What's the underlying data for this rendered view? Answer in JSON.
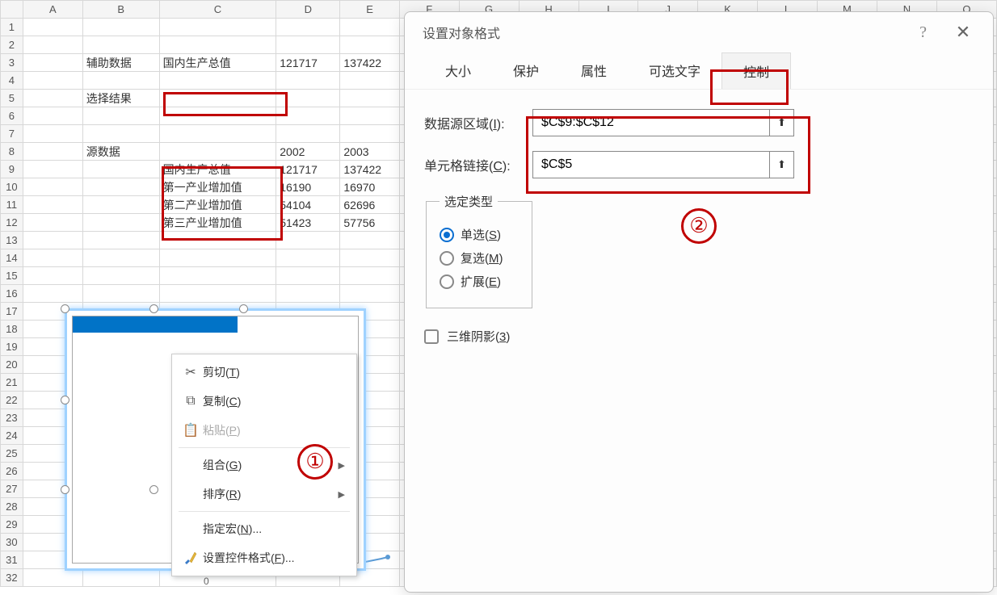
{
  "columns": [
    "A",
    "B",
    "C",
    "D",
    "E",
    "F",
    "G",
    "H",
    "I",
    "J",
    "K",
    "L",
    "M",
    "N",
    "O"
  ],
  "cells": {
    "B3": "辅助数据",
    "C3": "国内生产总值",
    "D3": "121717",
    "E3": "137422",
    "B5": "选择结果",
    "B8": "源数据",
    "D8": "2002",
    "E8": "2003",
    "C9": "国内生产总值",
    "D9": "121717",
    "E9": "137422",
    "C10": "第一产业增加值",
    "D10": "16190",
    "E10": "16970",
    "C11": "第二产业增加值",
    "D11": "54104",
    "E11": "62696",
    "C12": "第三产业增加值",
    "D12": "51423",
    "E12": "57756"
  },
  "axis_zero": "0",
  "ctx": {
    "cut": "剪切(T)",
    "copy": "复制(C)",
    "paste": "粘贴(P)",
    "group": "组合(G)",
    "sort": "排序(R)",
    "macro": "指定宏(N)...",
    "format": "设置控件格式(F)..."
  },
  "anno": {
    "one": "①",
    "two": "②"
  },
  "dialog": {
    "title": "设置对象格式",
    "tabs": {
      "size": "大小",
      "protect": "保护",
      "prop": "属性",
      "alt": "可选文字",
      "control": "控制"
    },
    "field_source": "数据源区域(I):",
    "field_link": "单元格链接(C):",
    "val_source": "$C$9:$C$12",
    "val_link": "$C$5",
    "seltype_legend": "选定类型",
    "opt_single": "单选(S)",
    "opt_multi": "复选(M)",
    "opt_ext": "扩展(E)",
    "shadow": "三维阴影(3)"
  }
}
